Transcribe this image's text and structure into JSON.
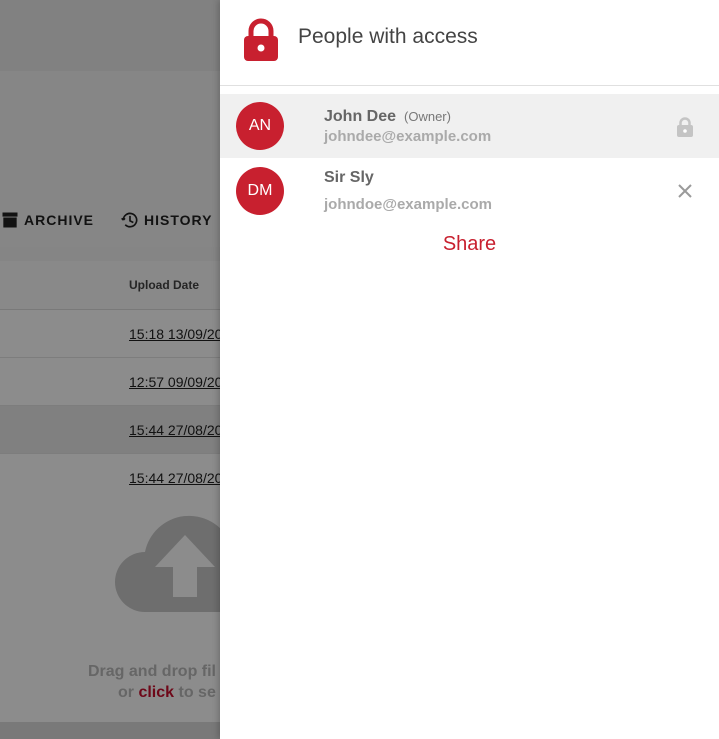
{
  "background": {
    "tabs": [
      {
        "label": "ARCHIVE",
        "icon": "archive-icon"
      },
      {
        "label": "HISTORY",
        "icon": "history-icon"
      }
    ],
    "table": {
      "header": "Upload Date",
      "rows": [
        "15:18 13/09/20",
        "12:57 09/09/20",
        "15:44 27/08/20",
        "15:44 27/08/20"
      ]
    },
    "drop": {
      "line1": "Drag and drop fil",
      "line2_prefix": "or ",
      "line2_click": "click",
      "line2_suffix": " to se"
    }
  },
  "drawer": {
    "title": "People with access",
    "title_icon": "lock-icon",
    "people": [
      {
        "initials": "AN",
        "name": "John Dee",
        "role": "(Owner)",
        "email": "johndee@example.com",
        "action_icon": "lock-icon"
      },
      {
        "initials": "DM",
        "name": "Sir Sly",
        "role": "",
        "email": "johndoe@example.com",
        "action_icon": "close-icon"
      }
    ],
    "share_label": "Share"
  },
  "colors": {
    "accent": "#c8202f",
    "overlay": "rgba(0,0,0,0.45)"
  }
}
